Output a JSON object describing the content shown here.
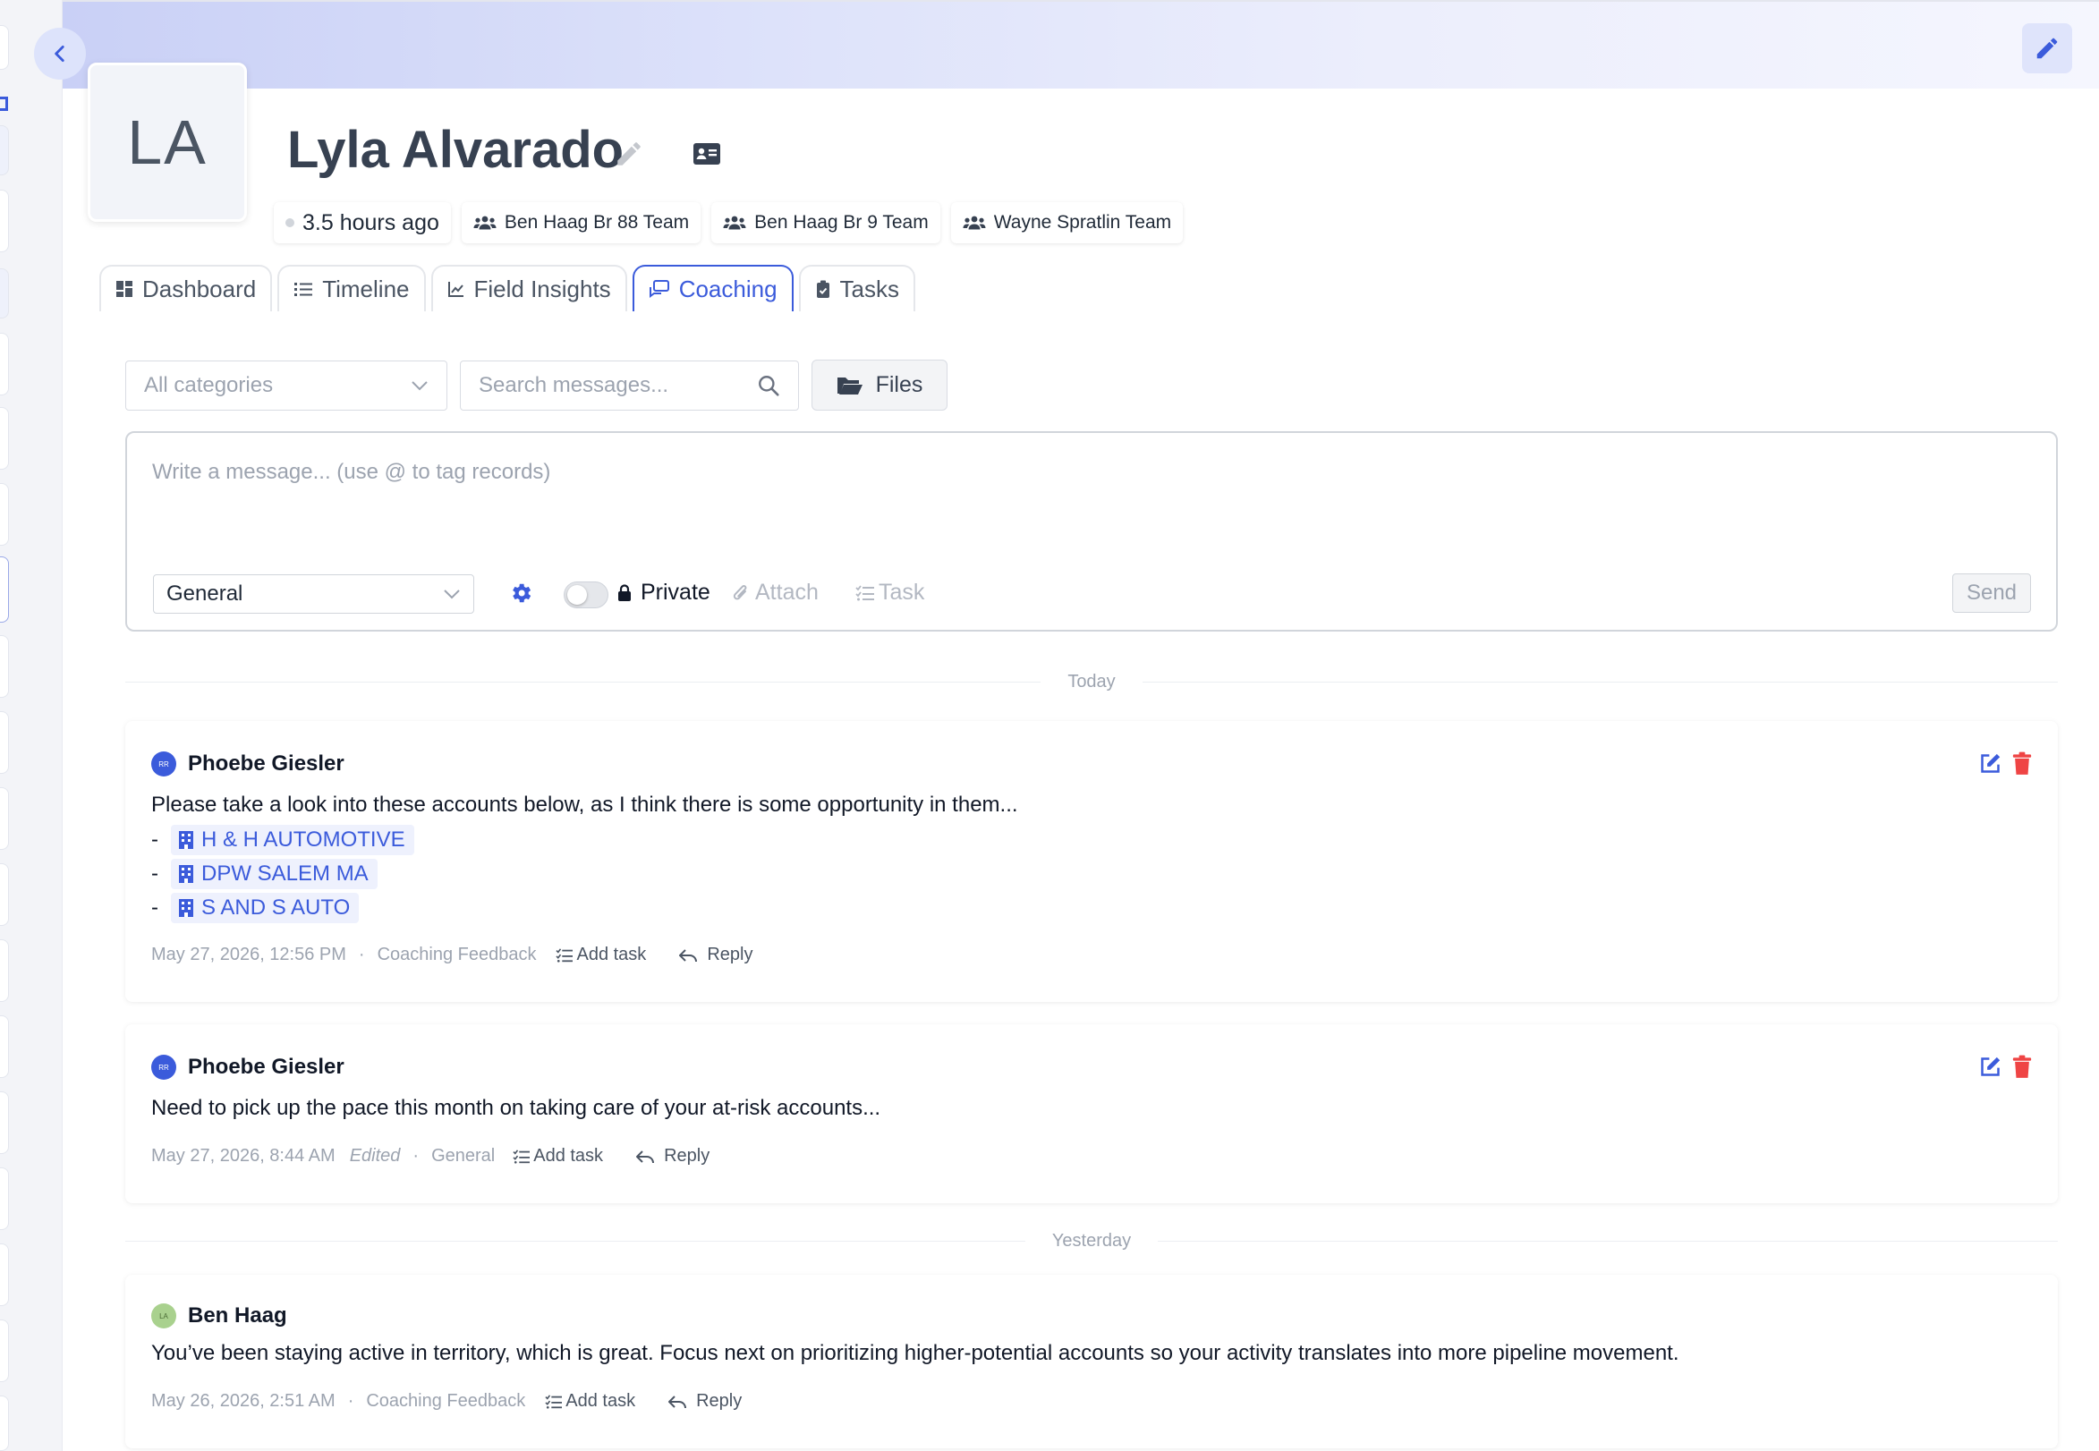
{
  "profile": {
    "initials": "LA",
    "name": "Lyla Alvarado",
    "last_active": "3.5 hours ago",
    "teams": [
      "Ben Haag Br 88 Team",
      "Ben Haag Br 9 Team",
      "Wayne Spratlin Team"
    ]
  },
  "tabs": [
    {
      "label": "Dashboard",
      "icon": "dashboard-icon"
    },
    {
      "label": "Timeline",
      "icon": "list-icon"
    },
    {
      "label": "Field Insights",
      "icon": "chart-line-icon"
    },
    {
      "label": "Coaching",
      "icon": "chat-icon",
      "active": true
    },
    {
      "label": "Tasks",
      "icon": "clipboard-icon"
    }
  ],
  "filters": {
    "category_placeholder": "All categories",
    "search_placeholder": "Search messages...",
    "files_label": "Files"
  },
  "composer": {
    "placeholder": "Write a message... (use @ to tag records)",
    "category_value": "General",
    "private_label": "Private",
    "attach_label": "Attach",
    "task_label": "Task",
    "send_label": "Send"
  },
  "dividers": {
    "today": "Today",
    "yesterday": "Yesterday"
  },
  "messages": [
    {
      "avatar": "RR",
      "author": "Phoebe Giesler",
      "text": "Please take a look into these accounts below, as I think there is some opportunity in them...",
      "accounts": [
        "H & H AUTOMOTIVE",
        "DPW SALEM MA",
        "S AND S AUTO"
      ],
      "bullet": "-",
      "timestamp": "May 27, 2026, 12:56 PM",
      "category": "Coaching Feedback",
      "add_task": "Add task",
      "reply": "Reply"
    },
    {
      "avatar": "RR",
      "author": "Phoebe Giesler",
      "text": "Need to pick up the pace this month on taking care of your at-risk accounts...",
      "timestamp": "May 27, 2026, 8:44 AM",
      "edited": "Edited",
      "category": "General",
      "add_task": "Add task",
      "reply": "Reply"
    },
    {
      "avatar": "LA",
      "author": "Ben Haag",
      "text": "You’ve been staying active in territory, which is great. Focus next on prioritizing higher-potential accounts so your activity translates into more pipeline movement.",
      "timestamp": "May 26, 2026, 2:51 AM",
      "category": "Coaching Feedback",
      "add_task": "Add task",
      "reply": "Reply"
    }
  ],
  "meta_separator": "·",
  "colors": {
    "accent": "#3b5bdb",
    "danger": "#ef4444",
    "text": "#111827",
    "muted": "#9ca3af"
  }
}
